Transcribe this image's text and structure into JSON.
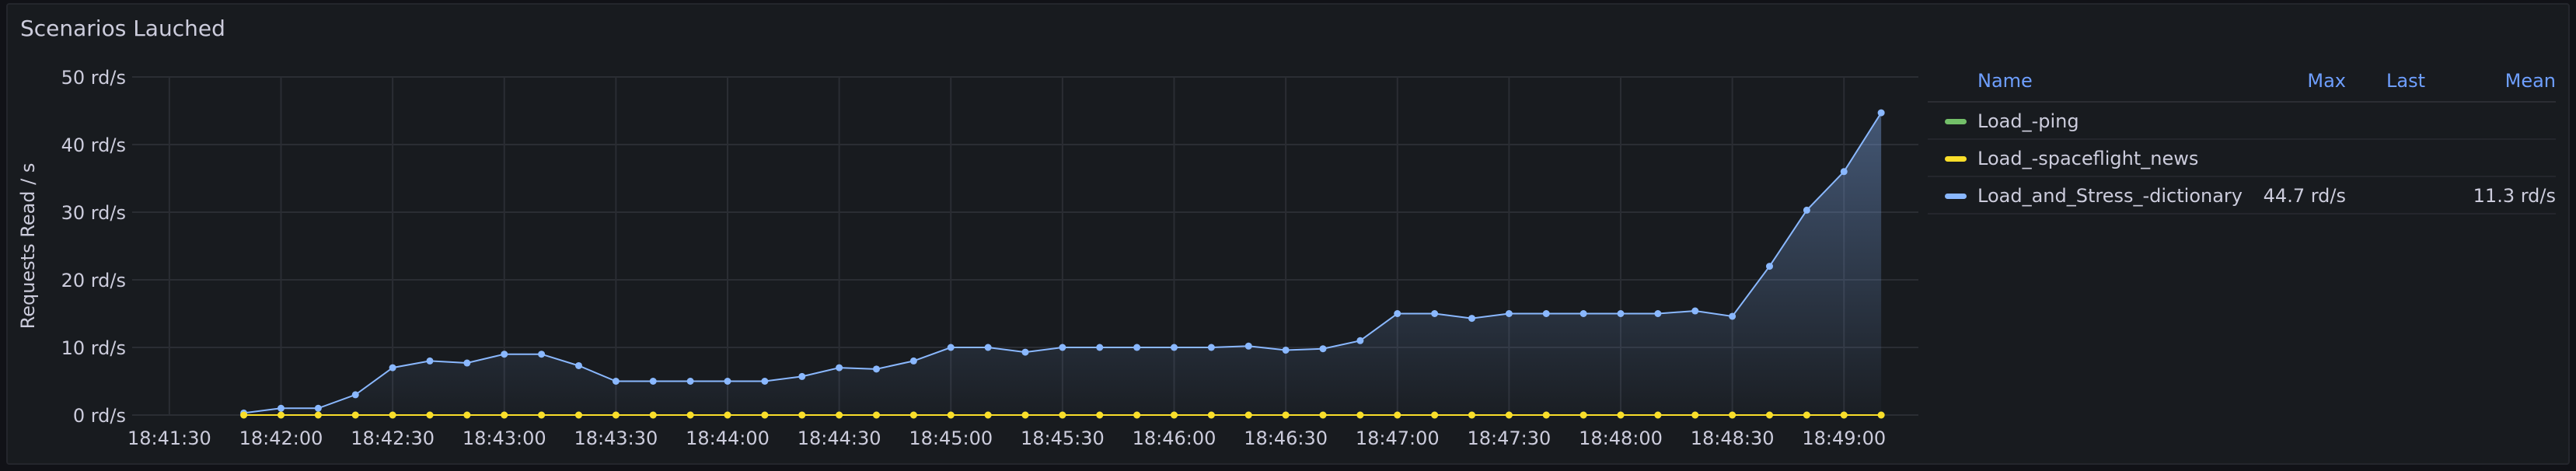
{
  "panel": {
    "title": "Scenarios Lauched"
  },
  "chart_data": {
    "type": "area",
    "ylabel": "Requests Read / s",
    "xlabel": "",
    "ylim": [
      0,
      50
    ],
    "yunit": "rd/s",
    "y_ticks": [
      "0 rd/s",
      "10 rd/s",
      "20 rd/s",
      "30 rd/s",
      "40 rd/s",
      "50 rd/s"
    ],
    "x_ticks": [
      "18:41:30",
      "18:42:00",
      "18:42:30",
      "18:43:00",
      "18:43:30",
      "18:44:00",
      "18:44:30",
      "18:45:00",
      "18:45:30",
      "18:46:00",
      "18:46:30",
      "18:47:00",
      "18:47:30",
      "18:48:00",
      "18:48:30",
      "18:49:00"
    ],
    "x_start": "18:41:20",
    "x_end": "18:49:20",
    "x": [
      "18:41:50",
      "18:42:00",
      "18:42:10",
      "18:42:20",
      "18:42:30",
      "18:42:40",
      "18:42:50",
      "18:43:00",
      "18:43:10",
      "18:43:20",
      "18:43:30",
      "18:43:40",
      "18:43:50",
      "18:44:00",
      "18:44:10",
      "18:44:20",
      "18:44:30",
      "18:44:40",
      "18:44:50",
      "18:45:00",
      "18:45:10",
      "18:45:20",
      "18:45:30",
      "18:45:40",
      "18:45:50",
      "18:46:00",
      "18:46:10",
      "18:46:20",
      "18:46:30",
      "18:46:40",
      "18:46:50",
      "18:47:00",
      "18:47:10",
      "18:47:20",
      "18:47:30",
      "18:47:40",
      "18:47:50",
      "18:48:00",
      "18:48:10",
      "18:48:20",
      "18:48:30",
      "18:48:40",
      "18:48:50",
      "18:49:00",
      "18:49:10"
    ],
    "series": [
      {
        "name": "Load_-ping",
        "color": "#73bf69",
        "values": [
          0,
          0,
          0,
          0,
          0,
          0,
          0,
          0,
          0,
          0,
          0,
          0,
          0,
          0,
          0,
          0,
          0,
          0,
          0,
          0,
          0,
          0,
          0,
          0,
          0,
          0,
          0,
          0,
          0,
          0,
          0,
          0,
          0,
          0,
          0,
          0,
          0,
          0,
          0,
          0,
          0,
          0,
          0,
          0,
          0
        ],
        "max": "",
        "last": "",
        "mean": ""
      },
      {
        "name": "Load_-spaceflight_news",
        "color": "#fade2a",
        "values": [
          0,
          0,
          0,
          0,
          0,
          0,
          0,
          0,
          0,
          0,
          0,
          0,
          0,
          0,
          0,
          0,
          0,
          0,
          0,
          0,
          0,
          0,
          0,
          0,
          0,
          0,
          0,
          0,
          0,
          0,
          0,
          0,
          0,
          0,
          0,
          0,
          0,
          0,
          0,
          0,
          0,
          0,
          0,
          0,
          0
        ],
        "max": "",
        "last": "",
        "mean": ""
      },
      {
        "name": "Load_and_Stress_-dictionary",
        "color": "#8ab8ff",
        "values": [
          0.3,
          1,
          1,
          3,
          7,
          8,
          7.7,
          9,
          9,
          7.3,
          5,
          5,
          5,
          5,
          5,
          5.7,
          7,
          6.8,
          8,
          10,
          10,
          9.3,
          10,
          10,
          10,
          10,
          10,
          10.2,
          9.6,
          9.8,
          11,
          15,
          15,
          14.3,
          15,
          15,
          15,
          15,
          15,
          15.4,
          14.6,
          22,
          30.3,
          36,
          44.7
        ],
        "max": "44.7 rd/s",
        "last": "",
        "mean": "11.3 rd/s"
      }
    ],
    "legend": {
      "placement": "right",
      "headers": {
        "name": "Name",
        "max": "Max",
        "last": "Last",
        "mean": "Mean"
      }
    }
  }
}
